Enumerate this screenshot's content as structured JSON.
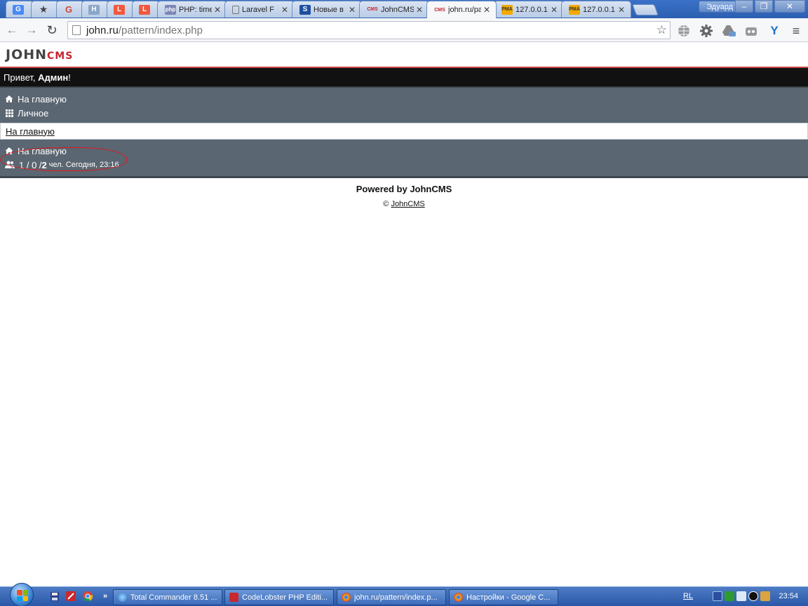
{
  "browser": {
    "tabs": [
      {
        "kind": "pinned",
        "icon": "google-translate-icon",
        "title": ""
      },
      {
        "kind": "pinned",
        "icon": "star-icon",
        "title": ""
      },
      {
        "kind": "pinned",
        "icon": "google-icon",
        "title": ""
      },
      {
        "kind": "pinned",
        "icon": "h-icon",
        "title": ""
      },
      {
        "kind": "pinned",
        "icon": "laravel-icon",
        "title": ""
      },
      {
        "kind": "pinned",
        "icon": "laravel-icon",
        "title": ""
      },
      {
        "kind": "normal",
        "icon": "php-icon",
        "title": "PHP: time"
      },
      {
        "kind": "normal",
        "icon": "page-icon",
        "title": "Laravel F"
      },
      {
        "kind": "normal",
        "icon": "stack-icon",
        "title": "Новые в"
      },
      {
        "kind": "normal",
        "icon": "johncms-icon",
        "title": "JohnCMS"
      },
      {
        "kind": "normal",
        "icon": "johncms-icon",
        "title": "john.ru/pa",
        "active": true
      },
      {
        "kind": "normal",
        "icon": "pma-icon",
        "title": "127.0.0.1"
      },
      {
        "kind": "normal",
        "icon": "pma-icon",
        "title": "127.0.0.1"
      }
    ],
    "user_name": "Эдуард",
    "window_controls": {
      "minimize": "‒",
      "restore": "❐",
      "close": "✕"
    },
    "url_host": "john.ru",
    "url_path": "/pattern/index.php"
  },
  "page": {
    "logo_main": "JOHN",
    "logo_sub": "CMS",
    "greeting_prefix": "Привет, ",
    "greeting_name": "Админ",
    "greeting_suffix": "!",
    "menu": [
      {
        "icon": "home-icon",
        "label": "На главную"
      },
      {
        "icon": "grid-icon",
        "label": "Личное"
      }
    ],
    "breadcrumb_link": "На главную",
    "bottom_home": "На главную",
    "stats_counts_a": "1 / 0 / ",
    "stats_counts_b": "2",
    "stats_suffix": "чел. Сегодня, 23:16",
    "powered_by": "Powered by JohnCMS",
    "copyright_symbol": "©",
    "copyright_link": "JohnCMS"
  },
  "taskbar": {
    "tasks": [
      {
        "icon": "total-commander-icon",
        "label": "Total Commander 8.51 ..."
      },
      {
        "icon": "codelobster-icon",
        "label": "CodeLobster PHP Editi..."
      },
      {
        "icon": "chrome-icon",
        "label": "john.ru/pattern/index.p..."
      },
      {
        "icon": "chrome-icon",
        "label": "Настройки - Google C..."
      }
    ],
    "language": "RL",
    "clock": "23:54",
    "more_glyph": "»"
  }
}
